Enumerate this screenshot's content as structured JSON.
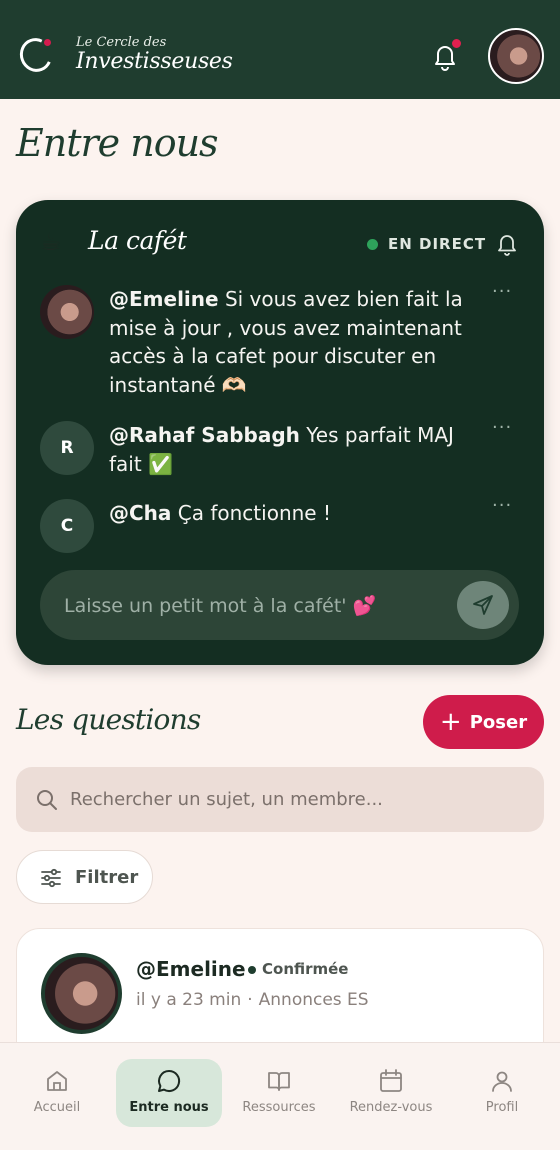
{
  "header": {
    "brand_small": "Le Cercle des",
    "brand_big": "Investisseuses",
    "icons": {
      "logo": "logo-ring-icon",
      "notifications": "bell-icon",
      "avatar": "user-avatar"
    },
    "colors": {
      "background": "#1f3d2f",
      "badge": "#e0204f"
    }
  },
  "page": {
    "title": "Entre nous"
  },
  "cafet": {
    "emoji": "☕",
    "title": "La cafét",
    "live_label": "EN DIRECT",
    "messages": [
      {
        "author": "@Emeline",
        "text": " Si vous avez bien fait la mise à jour , vous avez maintenant accès à la cafet pour discuter en instantané 🫶🏻",
        "initial": ""
      },
      {
        "author": "@Rahaf Sabbagh",
        "text": " Yes parfait MAJ fait ✅",
        "initial": "R"
      },
      {
        "author": "@Cha",
        "text": " Ça fonctionne !",
        "initial": "C"
      }
    ],
    "more_glyph": "···",
    "input_placeholder": "Laisse un petit mot à la cafét' 💕",
    "colors": {
      "card": "#142e22",
      "live": "#2ea35b"
    }
  },
  "questions": {
    "title": "Les questions",
    "ask_button": "Poser",
    "ask_plus": "+",
    "search_placeholder": "Rechercher un sujet, un membre...",
    "filter_label": "Filtrer",
    "colors": {
      "accent": "#cf1c4b"
    }
  },
  "post": {
    "author": "@Emeline",
    "status": "Confirmée",
    "time": "il y a 23 min",
    "separator": "·",
    "category": "Annonces ES"
  },
  "nav": {
    "items": [
      {
        "label": "Accueil",
        "icon": "home-icon"
      },
      {
        "label": "Entre nous",
        "icon": "chat-icon"
      },
      {
        "label": "Ressources",
        "icon": "book-icon"
      },
      {
        "label": "Rendez-vous",
        "icon": "calendar-icon"
      },
      {
        "label": "Profil",
        "icon": "user-icon"
      }
    ],
    "active_index": 1
  }
}
